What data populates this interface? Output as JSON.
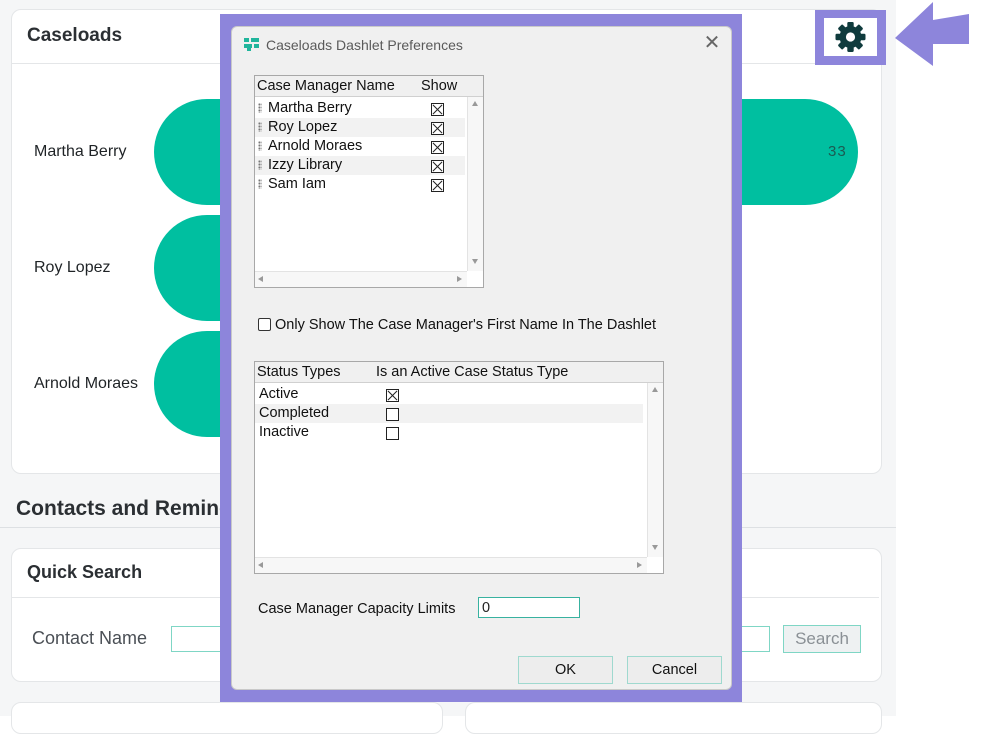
{
  "caseloads": {
    "title": "Caseloads",
    "managers": [
      {
        "name": "Martha Berry",
        "value": "33"
      },
      {
        "name": "Roy Lopez",
        "value": ""
      },
      {
        "name": "Arnold Moraes",
        "value": ""
      }
    ]
  },
  "contacts": {
    "title": "Contacts and Remind"
  },
  "quick_search": {
    "title": "Quick Search",
    "contact_name_label": "Contact Name",
    "search_button": "Search"
  },
  "dialog": {
    "title": "Caseloads Dashlet Preferences",
    "managers_table": {
      "headers": [
        "Case Manager Name",
        "Show"
      ],
      "rows": [
        {
          "name": "Martha Berry",
          "show": true
        },
        {
          "name": "Roy Lopez",
          "show": true
        },
        {
          "name": "Arnold Moraes",
          "show": true
        },
        {
          "name": "Izzy Library",
          "show": true
        },
        {
          "name": "Sam Iam",
          "show": true
        }
      ]
    },
    "first_name_only_label": "Only Show The Case Manager's First Name In The Dashlet",
    "first_name_only_checked": false,
    "status_table": {
      "headers": [
        "Status Types",
        "Is an Active Case Status Type"
      ],
      "rows": [
        {
          "name": "Active",
          "active": true
        },
        {
          "name": "Completed",
          "active": false
        },
        {
          "name": "Inactive",
          "active": false
        }
      ]
    },
    "capacity_label": "Case Manager Capacity Limits",
    "capacity_value": "0",
    "ok_label": "OK",
    "cancel_label": "Cancel"
  },
  "colors": {
    "accent_teal": "#00bfa0",
    "highlight_purple": "#8d85db",
    "gear_dark": "#0f3b3d"
  },
  "icons": [
    "gear-icon",
    "arrow-pointer-icon",
    "close-icon",
    "app-logo-icon",
    "grip-icon"
  ]
}
